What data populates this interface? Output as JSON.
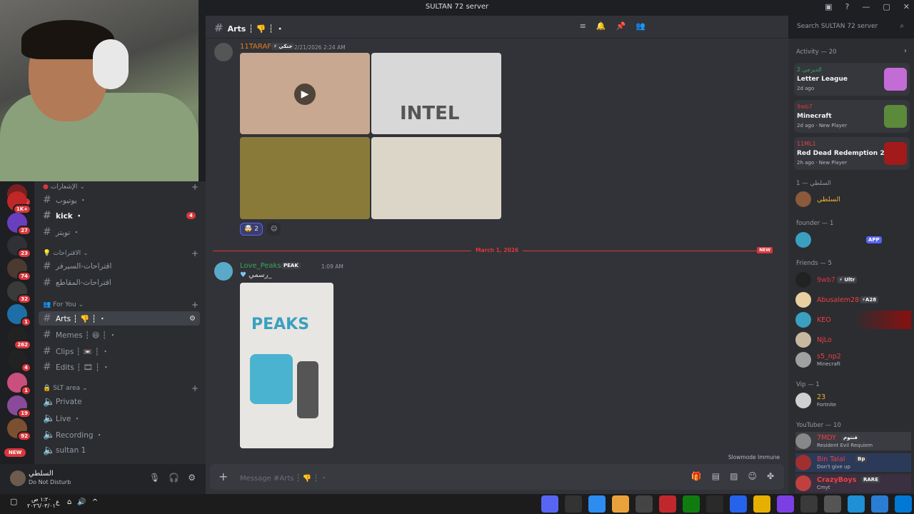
{
  "window": {
    "title": "SULTAN 72 server"
  },
  "channel": {
    "name": "Arts ┆ 👎 ┆ ・",
    "search_placeholder": "Search SULTAN 72 server"
  },
  "server_badges": [
    "1",
    "1K+",
    "27",
    "23",
    "74",
    "32",
    "1",
    "262",
    "4",
    "1",
    "19",
    "92",
    "NEW"
  ],
  "categories": {
    "c1": "الإشعارات",
    "c2": "الاقتراحات",
    "c3": "For You",
    "c4": "SLT area"
  },
  "channels": {
    "ch1": "يوتيوب ・",
    "ch2": "kick ・",
    "ch2_mentions": "4",
    "ch3": "تويتر ・",
    "ch4": "اقتراحات-السيرفر",
    "ch5": "اقتراحات-المقاطع",
    "ch6": "Arts ┆ 👎 ┆ ・",
    "ch7": "Memes ┆ 😆 ┆ ・",
    "ch8": "Clips ┆ 📼 ┆ ・",
    "ch9": "Edits ┆ 🎞 ┆ ・",
    "ch10": "Private",
    "ch11": "Live ・",
    "ch12": "Recording ・",
    "ch13": "sultan 1"
  },
  "user": {
    "name": "السلطي",
    "status": "Do Not Disturb"
  },
  "messages": [
    {
      "author": "11TARAF",
      "tag": "⚡ جنكي",
      "time": "2/21/2026 2:24 AM",
      "reaction_count": "2"
    },
    {
      "author": "Love_Peaks",
      "tag": "PEAK",
      "time": "1:09 AM",
      "text": "رسمي_",
      "image_text": "PEAKS"
    }
  ],
  "image_texts": {
    "intel": "INTEL"
  },
  "divider": {
    "label": "March 1, 2026",
    "new": "NEW"
  },
  "composer": {
    "placeholder": "Message #Arts ┆ 👎 ┆ ・",
    "slowmode": "Slowmode Immune"
  },
  "members": {
    "activity_header": "Activity — 20",
    "activities": [
      {
        "who": "الديرجي 2",
        "game": "Letter League",
        "meta": "2d ago",
        "color": "#3ba55d"
      },
      {
        "who": "9wb7",
        "game": "Minecraft",
        "meta": "2d ago · New Player",
        "color": "#da373c"
      },
      {
        "who": "11ML1",
        "game": "Red Dead Redemption 2",
        "meta": "2h ago · New Player",
        "color": "#f23f43"
      }
    ],
    "g1": "السلطي — 1",
    "g1_members": [
      {
        "name": "السلطي",
        "color": "#f0b232"
      }
    ],
    "g2": "founder — 1",
    "g2_members": [
      {
        "name": "",
        "tag": "APP"
      }
    ],
    "g3": "Friends — 5",
    "g3_members": [
      {
        "name": "9wb7",
        "tag": "⚡ Ultr",
        "color": "#da373c"
      },
      {
        "name": "Abusalem28",
        "tag": "⚡A28",
        "color": "#f23f43"
      },
      {
        "name": "KEO",
        "color": "#f23f43"
      },
      {
        "name": "NjLo",
        "color": "#f23f43"
      },
      {
        "name": "s5_np2",
        "sub": "Minecraft",
        "color": "#f23f43"
      }
    ],
    "g4": "Vip — 1",
    "g4_members": [
      {
        "name": "23",
        "sub": "Fortnite",
        "color": "#f0b232"
      }
    ],
    "g5": "YouTuber — 10",
    "g5_members": [
      {
        "name": "7MDY",
        "tag": "فنتوم",
        "sub": "Resident Evil Requiem",
        "color": "#f23f43"
      },
      {
        "name": "Bin Talal",
        "tag": "Bp",
        "sub": "Don't give up",
        "color": "#f23f43"
      },
      {
        "name": "CrazyBoys",
        "tag": "RARE",
        "sub": "Cmyt",
        "color": "#f23f43"
      }
    ]
  },
  "taskbar": {
    "time": "١:٢٠ ص",
    "date": "٢٠٢٦/٠٣/٠١",
    "lang": "ع"
  }
}
